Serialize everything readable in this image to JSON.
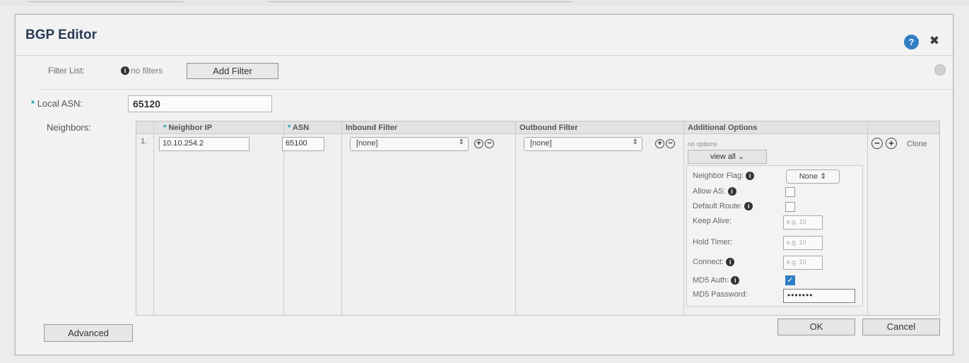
{
  "dialog": {
    "title": "BGP Editor",
    "help_icon": "question-icon",
    "close_icon": "close-icon"
  },
  "filter": {
    "label": "Filter List:",
    "value": "no filters",
    "add_button": "Add Filter"
  },
  "local_asn": {
    "label": "Local ASN:",
    "value": "65120"
  },
  "neighbors": {
    "label": "Neighbors:",
    "columns": {
      "ip": "Neighbor IP",
      "asn": "ASN",
      "inbound": "Inbound Filter",
      "outbound": "Outbound Filter",
      "options": "Additional Options"
    },
    "rows": [
      {
        "index": "1.",
        "ip": "10.10.254.2",
        "asn": "65100",
        "inbound": "[none]",
        "outbound": "[none]",
        "options_summary": "no options",
        "view_all": "view all",
        "clone": "Clone"
      }
    ]
  },
  "options": {
    "neighbor_flag_label": "Neighbor Flag:",
    "neighbor_flag_value": "None",
    "allow_as_label": "Allow AS:",
    "allow_as_checked": false,
    "default_route_label": "Default Route:",
    "default_route_checked": false,
    "keep_alive_label": "Keep Alive:",
    "keep_alive_placeholder": "e.g. 10",
    "hold_timer_label": "Hold Timer:",
    "hold_timer_placeholder": "e.g. 10",
    "connect_label": "Connect:",
    "connect_placeholder": "e.g. 10",
    "md5_auth_label": "MD5 Auth:",
    "md5_auth_checked": true,
    "md5_password_label": "MD5 Password:",
    "md5_password_value": "•••••••"
  },
  "footer": {
    "advanced": "Advanced",
    "ok": "OK",
    "cancel": "Cancel"
  },
  "colors": {
    "title": "#2b3a55",
    "required_star": "#1aa3a3",
    "accent": "#2f7ec4"
  }
}
